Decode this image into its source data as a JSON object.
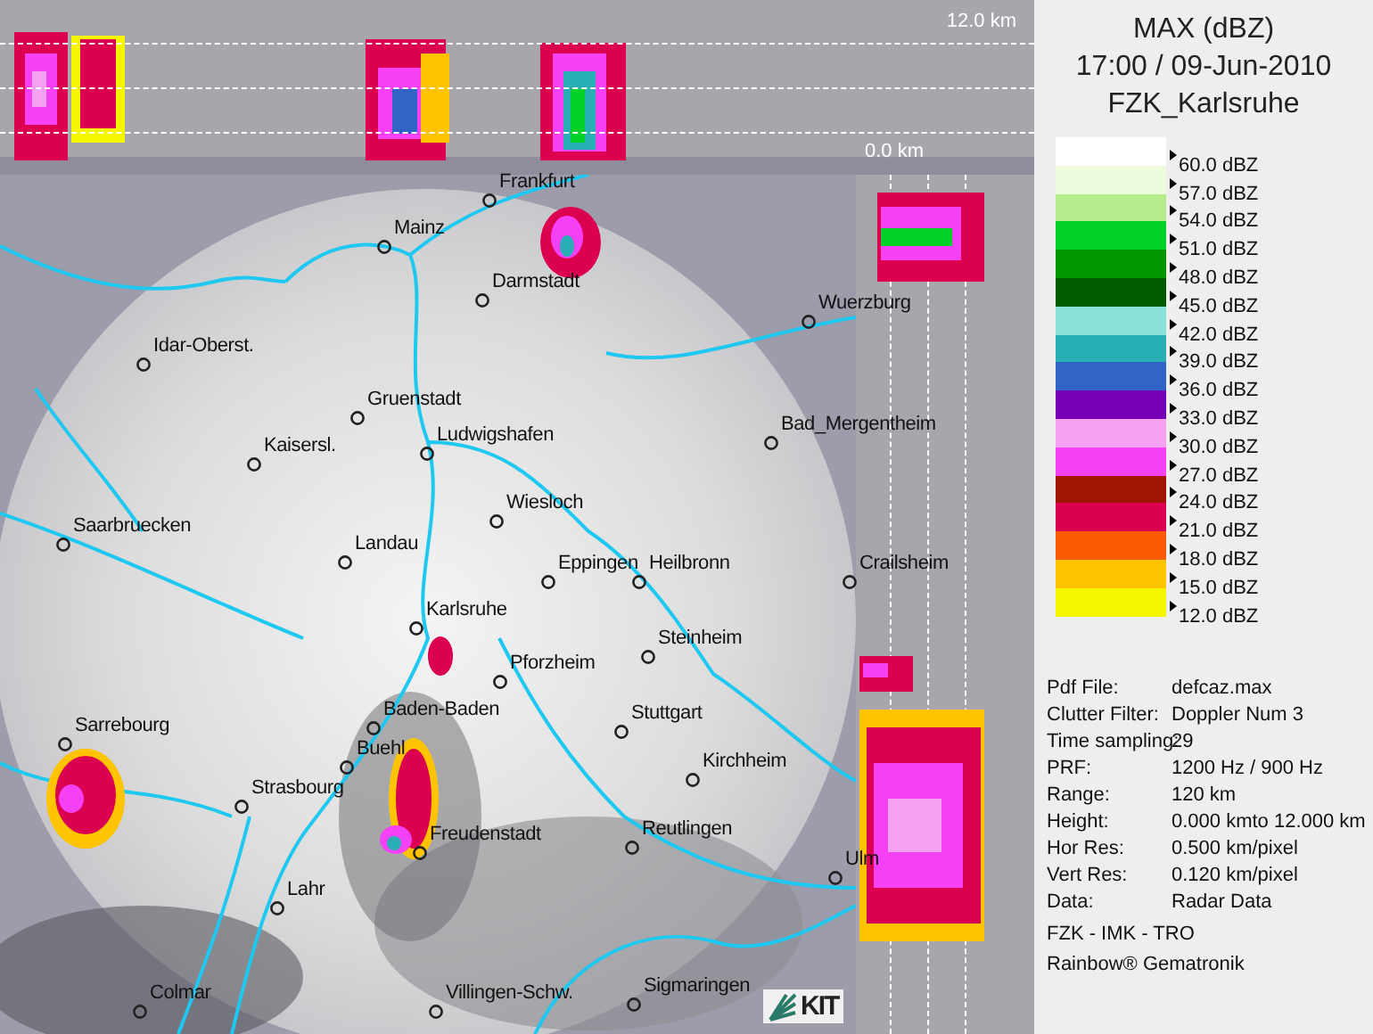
{
  "top_profile": {
    "top_label": "12.0 km",
    "bottom_label": "0.0 km"
  },
  "map": {
    "cities": [
      {
        "name": "Frankfurt"
      },
      {
        "name": "Mainz"
      },
      {
        "name": "Darmstadt"
      },
      {
        "name": "Idar-Oberst."
      },
      {
        "name": "Gruenstadt"
      },
      {
        "name": "Ludwigshafen"
      },
      {
        "name": "Kaisersl."
      },
      {
        "name": "Wuerzburg"
      },
      {
        "name": "Bad_Mergentheim"
      },
      {
        "name": "Wiesloch"
      },
      {
        "name": "Saarbruecken"
      },
      {
        "name": "Landau"
      },
      {
        "name": "Eppingen"
      },
      {
        "name": "Heilbronn"
      },
      {
        "name": "Crailsheim"
      },
      {
        "name": "Karlsruhe"
      },
      {
        "name": "Steinheim"
      },
      {
        "name": "Pforzheim"
      },
      {
        "name": "Baden-Baden"
      },
      {
        "name": "Stuttgart"
      },
      {
        "name": "Sarrebourg"
      },
      {
        "name": "Buehl"
      },
      {
        "name": "Kirchheim"
      },
      {
        "name": "Strasbourg"
      },
      {
        "name": "Freudenstadt"
      },
      {
        "name": "Reutlingen"
      },
      {
        "name": "Ulm"
      },
      {
        "name": "Lahr"
      },
      {
        "name": "Colmar"
      },
      {
        "name": "Villingen-Schw."
      },
      {
        "name": "Sigmaringen"
      }
    ],
    "logo": "KIT"
  },
  "panel": {
    "title": "MAX (dBZ)",
    "datetime": "17:00 / 09-Jun-2010",
    "station": "FZK_Karlsruhe",
    "legend": [
      {
        "label": "60.0 dBZ",
        "color": "#ffffff"
      },
      {
        "label": "57.0 dBZ",
        "color": "#eefadc"
      },
      {
        "label": "54.0 dBZ",
        "color": "#b4ec8c"
      },
      {
        "label": "51.0 dBZ",
        "color": "#00d22a"
      },
      {
        "label": "48.0 dBZ",
        "color": "#009600"
      },
      {
        "label": "45.0 dBZ",
        "color": "#005a00"
      },
      {
        "label": "42.0 dBZ",
        "color": "#8ce1d7"
      },
      {
        "label": "39.0 dBZ",
        "color": "#28afb4"
      },
      {
        "label": "36.0 dBZ",
        "color": "#3264c8"
      },
      {
        "label": "33.0 dBZ",
        "color": "#7800b4"
      },
      {
        "label": "30.0 dBZ",
        "color": "#f5a0f0"
      },
      {
        "label": "27.0 dBZ",
        "color": "#f541f5"
      },
      {
        "label": "24.0 dBZ",
        "color": "#a01400"
      },
      {
        "label": "21.0 dBZ",
        "color": "#dc0050"
      },
      {
        "label": "18.0 dBZ",
        "color": "#fa5a00"
      },
      {
        "label": "15.0 dBZ",
        "color": "#ffc300"
      },
      {
        "label": "12.0 dBZ",
        "color": "#f5f500"
      }
    ],
    "info": [
      {
        "label": "Pdf File:",
        "value": "defcaz.max"
      },
      {
        "label": "Clutter Filter:",
        "value": "Doppler Num 3"
      },
      {
        "label": "Time sampling:",
        "value": "29"
      },
      {
        "label": "PRF:",
        "value": "1200 Hz / 900 Hz"
      },
      {
        "label": "Range:",
        "value": "120 km"
      },
      {
        "label": "Height:",
        "value": "0.000 kmto 12.000 km"
      },
      {
        "label": "Hor Res:",
        "value": "0.500 km/pixel"
      },
      {
        "label": "Vert Res:",
        "value": "0.120 km/pixel"
      },
      {
        "label": "Data:",
        "value": "Radar Data"
      }
    ],
    "credits": [
      "FZK - IMK - TRO",
      "Rainbow® Gematronik"
    ]
  }
}
